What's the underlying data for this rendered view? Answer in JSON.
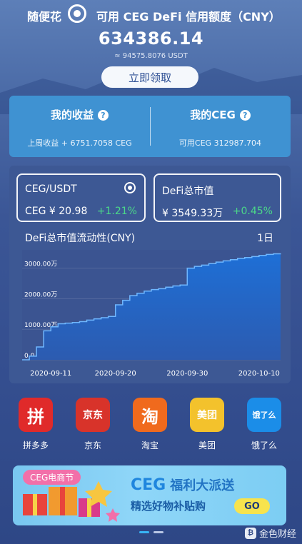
{
  "header": {
    "brand": "随便花",
    "credit_title": "可用 CEG DeFi 信用额度（CNY）",
    "credit_amount": "634386.14",
    "credit_usdt": "≈ 94575.8076 USDT",
    "claim_button": "立即领取"
  },
  "earnings": {
    "left_title": "我的收益",
    "left_sub": "上周收益 + 6751.7058 CEG",
    "right_title": "我的CEG",
    "right_sub": "可用CEG 312987.704",
    "help_icon": "question-circle-icon"
  },
  "market": {
    "pair": {
      "name": "CEG/USDT",
      "price": "CEG ¥ 20.98",
      "change": "+1.21%",
      "icon": "ceg-logo-icon"
    },
    "defi": {
      "name": "DeFi总市值",
      "price": "¥ 3549.33万",
      "change": "+0.45%"
    },
    "change_color": "#4bd889"
  },
  "chart_data": {
    "type": "area",
    "title": "DeFi总市值流动性(CNY)",
    "period_label": "1日",
    "y_ticks": [
      "0.0",
      "1000.00万",
      "2000.00万",
      "3000.00万"
    ],
    "x_ticks": [
      "2020-09-11",
      "2020-09-20",
      "2020-09-30",
      "2020-10-10"
    ],
    "ylim": [
      0,
      3600
    ],
    "y_unit": "万",
    "x_start": "2020-09-07",
    "x_end": "2020-10-13",
    "x": [
      "2020-09-07",
      "2020-09-08",
      "2020-09-09",
      "2020-09-10",
      "2020-09-11",
      "2020-09-12",
      "2020-09-13",
      "2020-09-14",
      "2020-09-15",
      "2020-09-16",
      "2020-09-17",
      "2020-09-18",
      "2020-09-19",
      "2020-09-20",
      "2020-09-21",
      "2020-09-22",
      "2020-09-23",
      "2020-09-24",
      "2020-09-25",
      "2020-09-26",
      "2020-09-27",
      "2020-09-28",
      "2020-09-29",
      "2020-09-30",
      "2020-10-01",
      "2020-10-02",
      "2020-10-03",
      "2020-10-04",
      "2020-10-05",
      "2020-10-06",
      "2020-10-07",
      "2020-10-08",
      "2020-10-09",
      "2020-10-10",
      "2020-10-11",
      "2020-10-12",
      "2020-10-13"
    ],
    "values": [
      0,
      120,
      420,
      950,
      1080,
      1180,
      1200,
      1220,
      1250,
      1300,
      1340,
      1380,
      1420,
      1800,
      1950,
      2100,
      2180,
      2250,
      2300,
      2330,
      2380,
      2420,
      2450,
      3000,
      3060,
      3100,
      3150,
      3200,
      3240,
      3280,
      3320,
      3350,
      3380,
      3420,
      3450,
      3470,
      3480
    ],
    "fill_color": "#1e6fd6",
    "line_color": "#6fb7ff",
    "grid": true
  },
  "apps": [
    {
      "label": "拼多多",
      "tile_text": "拼",
      "bg": "#e02a2a",
      "icon": "pinduoduo-icon"
    },
    {
      "label": "京东",
      "tile_text": "京东",
      "bg": "#d8332a",
      "icon": "jd-icon"
    },
    {
      "label": "淘宝",
      "tile_text": "淘",
      "bg": "#f06a1d",
      "icon": "taobao-icon"
    },
    {
      "label": "美团",
      "tile_text": "美团",
      "bg": "#f3c22c",
      "icon": "meituan-icon"
    },
    {
      "label": "饿了么",
      "tile_text": "饿了么",
      "bg": "#1b8de8",
      "icon": "eleme-icon"
    }
  ],
  "banner": {
    "tag": "CEG电商节",
    "headline_big": "CEG",
    "headline": "福利大派送",
    "sub": "精选好物补贴购",
    "go": "GO"
  },
  "watermark": "金色财经"
}
